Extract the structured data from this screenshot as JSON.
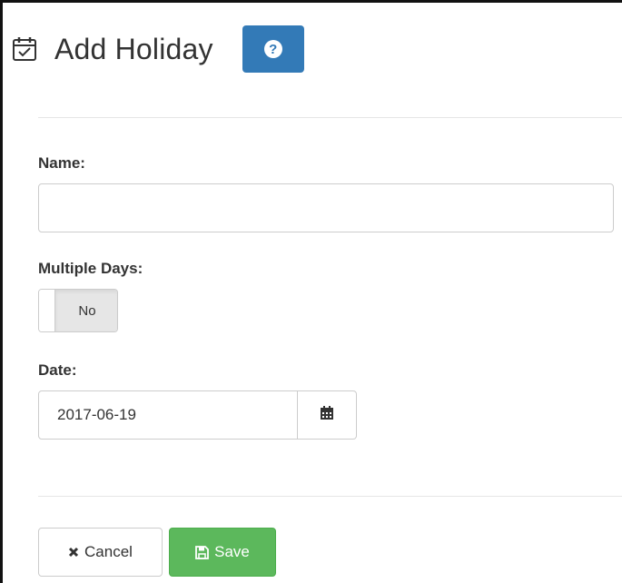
{
  "header": {
    "title": "Add Holiday",
    "title_icon": "calendar-check-icon",
    "help_icon": "question-circle-icon",
    "help_glyph": "?",
    "help_color": "#337ab7"
  },
  "form": {
    "name": {
      "label": "Name:",
      "value": "",
      "placeholder": ""
    },
    "multiple_days": {
      "label": "Multiple Days:",
      "toggle_text": "No",
      "checked": false
    },
    "date": {
      "label": "Date:",
      "value": "2017-06-19",
      "addon_icon": "calendar-icon"
    }
  },
  "actions": {
    "cancel": {
      "label": "Cancel",
      "icon": "times-icon"
    },
    "save": {
      "label": "Save",
      "icon": "floppy-disk-icon",
      "color": "#5cb85c"
    }
  }
}
